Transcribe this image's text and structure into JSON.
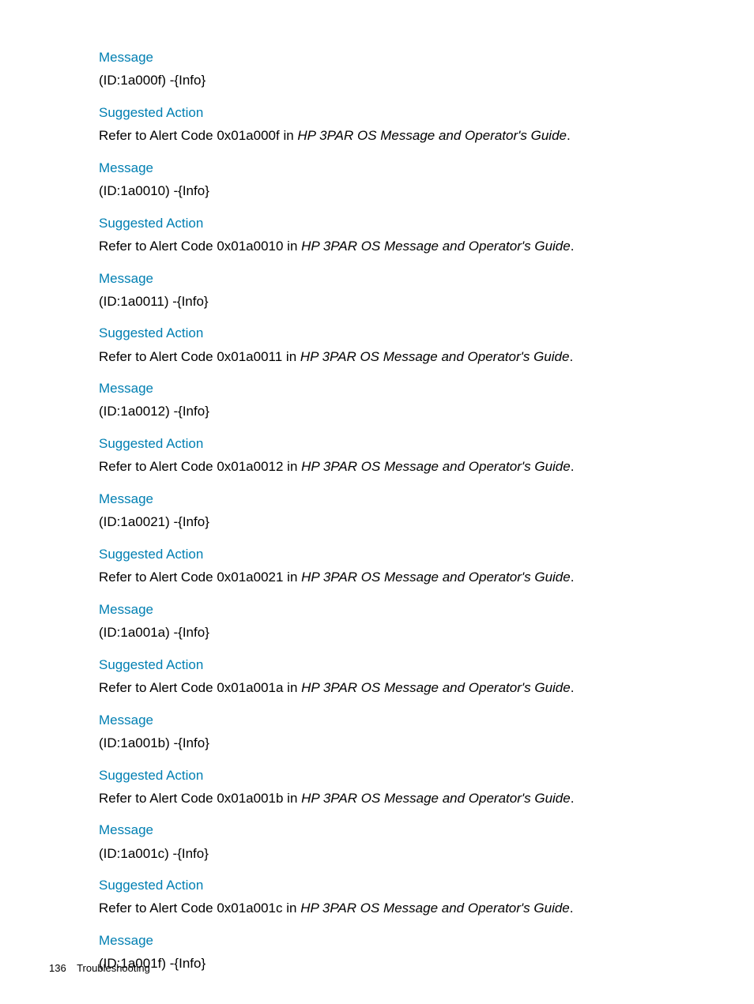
{
  "labels": {
    "message": "Message",
    "suggested_action": "Suggested Action",
    "refer_prefix": "Refer to Alert Code ",
    "refer_mid": " in ",
    "guide_title": "HP 3PAR OS Message and Operator's Guide",
    "period": "."
  },
  "entries": [
    {
      "msg": "(ID:1a000f) -{Info}",
      "code": "0x01a000f"
    },
    {
      "msg": "(ID:1a0010) -{Info}",
      "code": "0x01a0010"
    },
    {
      "msg": "(ID:1a0011) -{Info}",
      "code": "0x01a0011"
    },
    {
      "msg": "(ID:1a0012) -{Info}",
      "code": "0x01a0012"
    },
    {
      "msg": "(ID:1a0021) -{Info}",
      "code": "0x01a0021"
    },
    {
      "msg": "(ID:1a001a) -{Info}",
      "code": "0x01a001a"
    },
    {
      "msg": "(ID:1a001b) -{Info}",
      "code": "0x01a001b"
    },
    {
      "msg": "(ID:1a001c) -{Info}",
      "code": "0x01a001c"
    },
    {
      "msg": "(ID:1a001f) -{Info}",
      "code": null
    }
  ],
  "footer": {
    "page_number": "136",
    "section": "Troubleshooting"
  }
}
